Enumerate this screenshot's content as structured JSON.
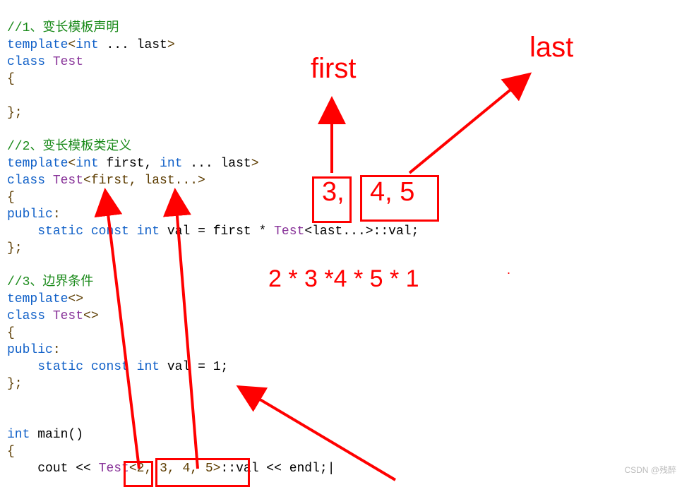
{
  "code": {
    "c1": "//1、变长模板声明",
    "l2_kw_template": "template",
    "l2_lt": "<",
    "l2_int": "int",
    "l2_dots": " ... last",
    "l2_gt": ">",
    "l3_kw_class": "class",
    "l3_name": " Test",
    "l4": "{",
    "l5": "};",
    "c2": "//2、变长模板类定义",
    "l8_kw_template": "template",
    "l8_lt": "<",
    "l8_int1": "int",
    "l8_first": " first, ",
    "l8_int2": "int",
    "l8_dots": " ... last",
    "l8_gt": ">",
    "l9_kw_class": "class",
    "l9_name": " Test",
    "l9_spec": "<first, last...>",
    "l10": "{",
    "l11_kw_public": "public",
    "l11_colon": ":",
    "l12_indent": "    ",
    "l12_static": "static",
    "l12_sp1": " ",
    "l12_const": "const",
    "l12_sp2": " ",
    "l12_int": "int",
    "l12_rest1": " val = first * ",
    "l12_test": "Test",
    "l12_rest2": "<last...>::val;",
    "l13": "};",
    "c3": "//3、边界条件",
    "l16_kw_template": "template",
    "l16_ang": "<>",
    "l17_kw_class": "class",
    "l17_name": " Test",
    "l17_ang": "<>",
    "l18": "{",
    "l19_kw_public": "public",
    "l19_colon": ":",
    "l20_indent": "    ",
    "l20_static": "static",
    "l20_sp1": " ",
    "l20_const": "const",
    "l20_sp2": " ",
    "l20_int": "int",
    "l20_rest": " val = 1;",
    "l21": "};",
    "l24_int": "int",
    "l24_main": " main()",
    "l25": "{",
    "l26_indent": "    ",
    "l26_cout": "cout << ",
    "l26_test": "Test",
    "l26_args": "<2, 3, 4, 5>",
    "l26_rest": "::val << endl;",
    "l26_cursor": "|"
  },
  "annotations": {
    "first_label": "first",
    "last_label": "last",
    "boxed_numbers_3": "3,",
    "boxed_numbers_45": "4, 5",
    "expression": "2 * 3 *4 * 5 * 1",
    "dot": "."
  },
  "watermark": "CSDN @残醉"
}
